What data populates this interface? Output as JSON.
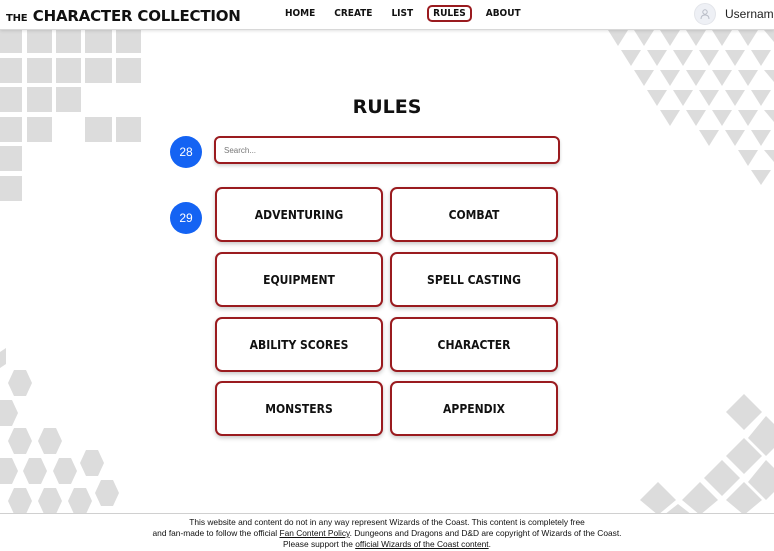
{
  "header": {
    "brand_small": "THE",
    "brand_big": "CHARACTER COLLECTION",
    "nav": [
      "HOME",
      "CREATE",
      "LIST",
      "RULES",
      "ABOUT"
    ],
    "active_nav": "RULES",
    "username": "Username",
    "avatar_icon": "user-icon"
  },
  "main": {
    "title": "RULES",
    "search_placeholder": "Search...",
    "badge_search": "28",
    "badge_grid": "29",
    "categories": [
      "ADVENTURING",
      "COMBAT",
      "EQUIPMENT",
      "SPELL CASTING",
      "ABILITY SCORES",
      "CHARACTER",
      "MONSTERS",
      "APPENDIX"
    ]
  },
  "colors": {
    "accent_border": "#9a1b1f",
    "badge": "#1463f3",
    "decor_gray": "#dcdcdc"
  },
  "footer": {
    "line1": "This website and content do not in any way represent Wizards of the Coast. This content is completely free",
    "line2_pre": "and fan-made to follow the official ",
    "line2_link": "Fan Content Policy",
    "line2_post": ". Dungeons and Dragons and D&D are copyright of Wizards of the Coast.",
    "line3_pre": "Please support the ",
    "line3_link": "official Wizards of the Coast content",
    "line3_post": "."
  }
}
